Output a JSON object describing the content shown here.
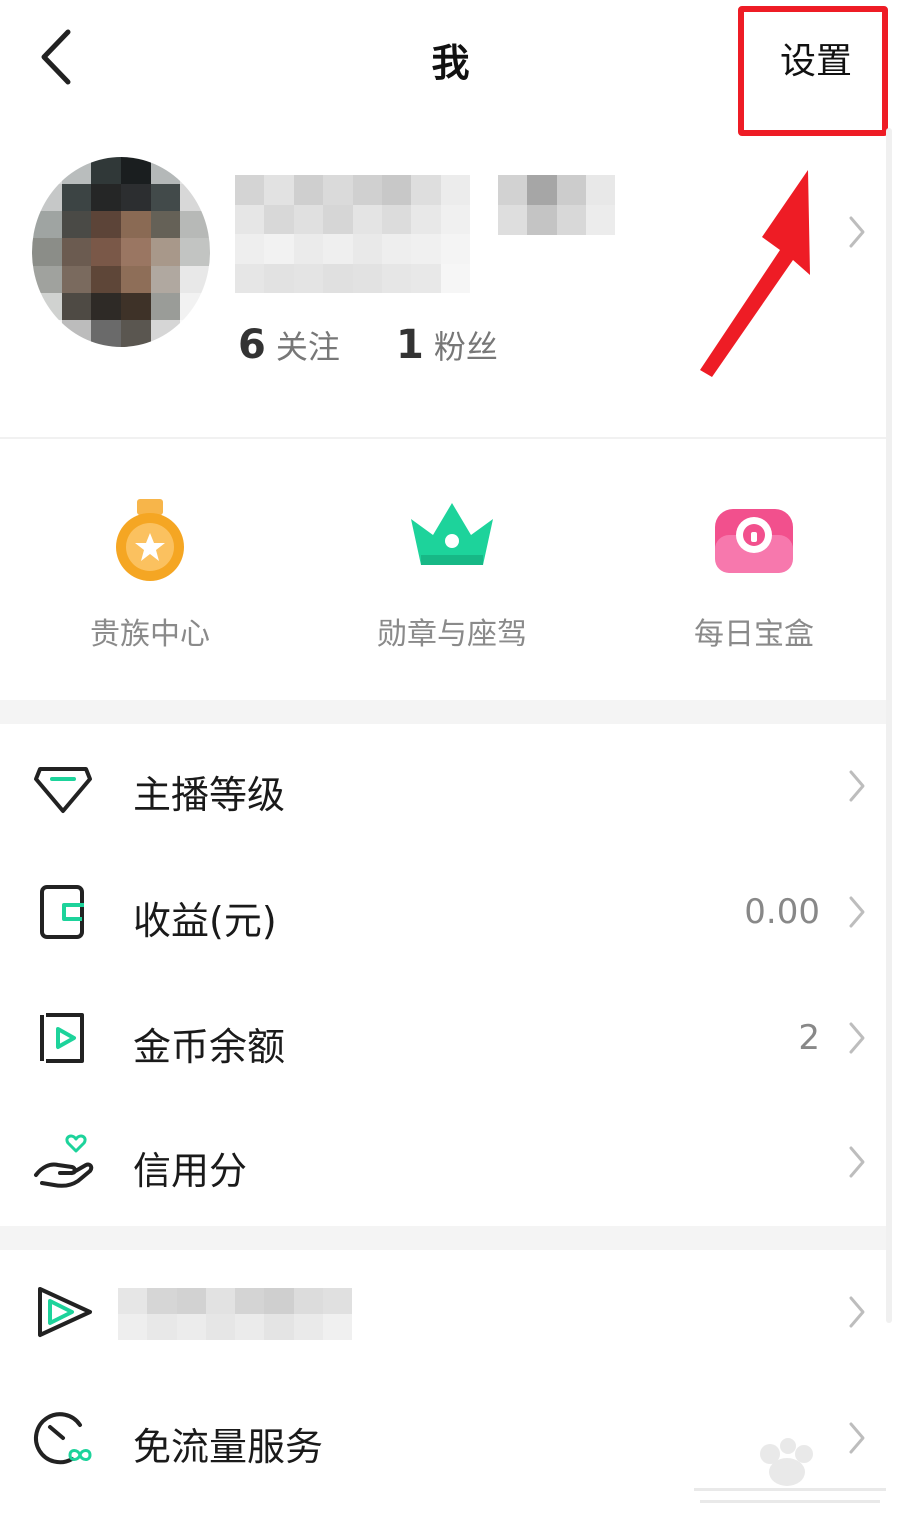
{
  "header": {
    "title": "我",
    "settings_label": "设置"
  },
  "profile": {
    "stats": [
      {
        "value": "6",
        "label": "关注"
      },
      {
        "value": "1",
        "label": "粉丝"
      }
    ]
  },
  "quick_actions": [
    {
      "label": "贵族中心",
      "icon": "medal-icon"
    },
    {
      "label": "勋章与座驾",
      "icon": "crown-icon"
    },
    {
      "label": "每日宝盒",
      "icon": "treasure-box-icon"
    }
  ],
  "menu": [
    {
      "label": "主播等级",
      "value": "",
      "icon": "diamond-icon"
    },
    {
      "label": "收益(元)",
      "value": "0.00",
      "icon": "wallet-icon"
    },
    {
      "label": "金币余额",
      "value": "2",
      "icon": "coin-video-icon"
    },
    {
      "label": "信用分",
      "value": "",
      "icon": "hand-heart-icon"
    }
  ],
  "menu2": [
    {
      "label": "",
      "value": "",
      "icon": "play-app-icon"
    },
    {
      "label": "免流量服务",
      "value": "",
      "icon": "data-free-icon"
    }
  ],
  "colors": {
    "accent_green": "#1dd39b",
    "annotation_red": "#ee1c25",
    "medal_orange": "#f5a623",
    "box_pink": "#f2508d"
  }
}
